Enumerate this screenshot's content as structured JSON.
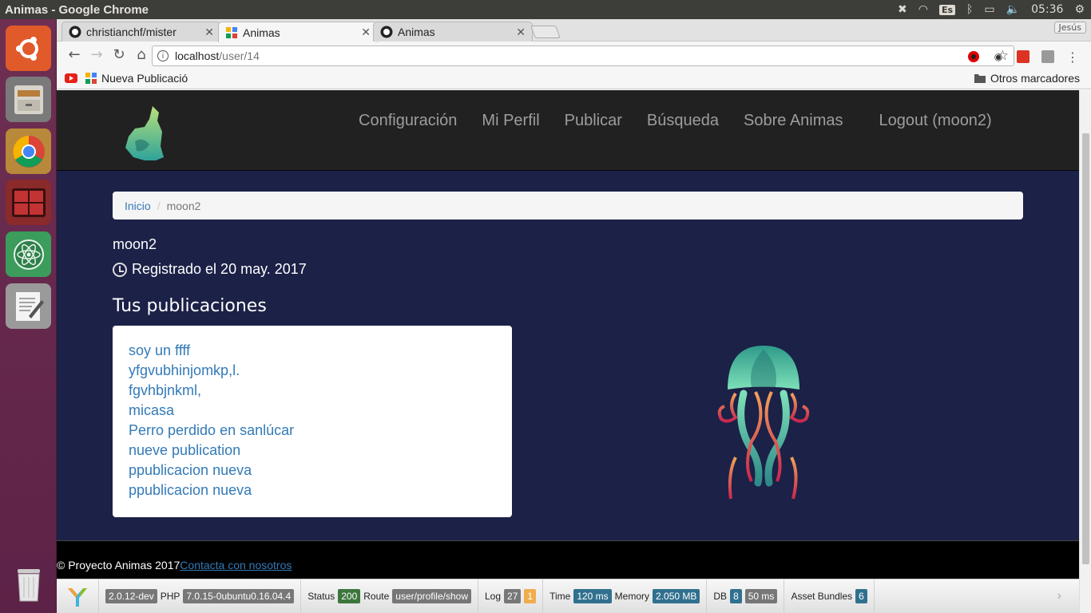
{
  "os": {
    "window_title": "Animas - Google Chrome",
    "keyboard_layout": "Es",
    "clock": "05:36"
  },
  "browser": {
    "tabs": [
      {
        "label": "christianchf/mister",
        "favicon": "github-icon",
        "active": false
      },
      {
        "label": "Animas",
        "favicon": "animas-favicon-icon",
        "active": true
      },
      {
        "label": "Animas",
        "favicon": "github-icon",
        "active": false
      }
    ],
    "profile": "Jesús",
    "url_host": "localhost",
    "url_path": "/user/14",
    "bookmarks": {
      "items": [
        {
          "label": "Nueva Publicació"
        }
      ],
      "other": "Otros marcadores"
    }
  },
  "site": {
    "nav": [
      {
        "label": "Configuración"
      },
      {
        "label": "Mi Perfil"
      },
      {
        "label": "Publicar"
      },
      {
        "label": "Búsqueda"
      },
      {
        "label": "Sobre Animas"
      },
      {
        "label": "Logout (moon2)"
      }
    ],
    "breadcrumb": {
      "home": "Inicio",
      "current": "moon2"
    },
    "profile": {
      "username": "moon2",
      "registered": "Registrado el 20 may. 2017"
    },
    "publications_title": "Tus publicaciones",
    "publications": [
      "soy un ffff",
      "yfgvubhinjomkp,l.",
      "fgvhbjnkml,",
      "micasa",
      "Perro perdido en sanlúcar",
      "nueve publication",
      "ppublicacion nueva",
      "ppublicacion nueva"
    ],
    "footer": {
      "copyright": "© Proyecto Animas 2017",
      "contact": "Contacta con nosotros"
    }
  },
  "debug_toolbar": {
    "yii_version": "2.0.12-dev",
    "php_label": "PHP",
    "php_version": "7.0.15-0ubuntu0.16.04.4",
    "status_label": "Status",
    "status": "200",
    "route_label": "Route",
    "route": "user/profile/show",
    "log_label": "Log",
    "log_count": "27",
    "log_warn": "1",
    "time_label": "Time",
    "time": "120 ms",
    "memory_label": "Memory",
    "memory": "2.050 MB",
    "db_label": "DB",
    "db_count": "8",
    "db_time": "50 ms",
    "assets_label": "Asset Bundles",
    "assets_count": "6"
  }
}
